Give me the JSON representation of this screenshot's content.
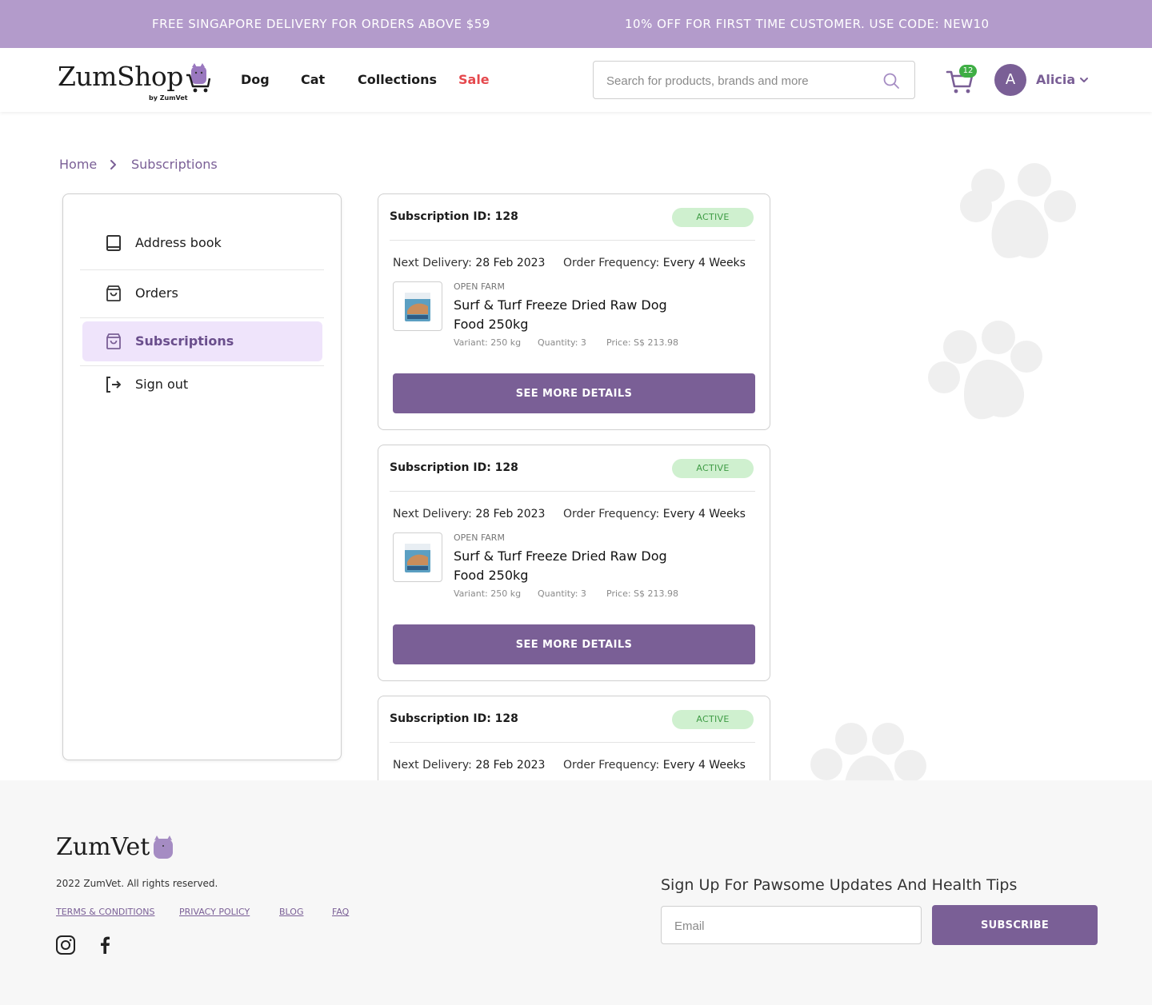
{
  "promo": {
    "left_text": "FREE SINGAPORE DELIVERY FOR ORDERS ABOVE $59",
    "right_text": "10% OFF FOR FIRST TIME CUSTOMER. USE CODE: NEW10"
  },
  "header": {
    "logo_text": "ZumShop",
    "logo_sub": "by ZumVet",
    "nav": [
      {
        "label": "Dog"
      },
      {
        "label": "Cat"
      },
      {
        "label": "Collections"
      },
      {
        "label": "Sale"
      }
    ],
    "search_placeholder": "Search for products, brands and more",
    "cart_count": "12",
    "user_initial": "A",
    "user_name": "Alicia"
  },
  "breadcrumb": {
    "home": "Home",
    "current": "Subscriptions"
  },
  "sidebar": {
    "items": [
      {
        "label": "Address book",
        "icon": "book-icon"
      },
      {
        "label": "Orders",
        "icon": "bag-icon"
      },
      {
        "label": "Subscriptions",
        "icon": "bag-icon",
        "active": true
      },
      {
        "label": "Sign out",
        "icon": "sign-out-icon"
      }
    ]
  },
  "subscriptions": [
    {
      "id_label": "Subscription ID: 128",
      "status": "ACTIVE",
      "next_delivery_label": "Next Delivery:",
      "next_delivery_value": "28 Feb 2023",
      "frequency_label": "Order Frequency:",
      "frequency_value": "Every 4 Weeks",
      "brand": "OPEN FARM",
      "product_name": "Surf & Turf Freeze Dried Raw Dog Food 250kg",
      "variant": "Variant: 250 kg",
      "quantity": "Quantity: 3",
      "price": "Price: S$ 213.98",
      "button_label": "SEE MORE DETAILS"
    },
    {
      "id_label": "Subscription ID: 128",
      "status": "ACTIVE",
      "next_delivery_label": "Next Delivery:",
      "next_delivery_value": "28 Feb 2023",
      "frequency_label": "Order Frequency:",
      "frequency_value": "Every 4 Weeks",
      "brand": "OPEN FARM",
      "product_name": "Surf & Turf Freeze Dried Raw Dog Food 250kg",
      "variant": "Variant: 250 kg",
      "quantity": "Quantity: 3",
      "price": "Price: S$ 213.98",
      "button_label": "SEE MORE DETAILS"
    },
    {
      "id_label": "Subscription ID: 128",
      "status": "ACTIVE",
      "next_delivery_label": "Next Delivery:",
      "next_delivery_value": "28 Feb 2023",
      "frequency_label": "Order Frequency:",
      "frequency_value": "Every 4 Weeks"
    }
  ],
  "footer": {
    "logo_text": "ZumVet",
    "copyright": "2022 ZumVet. All rights reserved.",
    "links": [
      {
        "label": "TERMS & CONDITIONS"
      },
      {
        "label": "PRIVACY POLICY"
      },
      {
        "label": "BLOG"
      },
      {
        "label": "FAQ"
      }
    ],
    "social": [
      "instagram-icon",
      "facebook-icon"
    ],
    "newsletter_title": "Sign Up For Pawsome Updates And Health Tips",
    "email_placeholder": "Email",
    "subscribe_label": "SUBSCRIBE"
  },
  "colors": {
    "promo_bg": "#b39bcb",
    "brand_purple": "#7a5f96",
    "sale_red": "#e5484d",
    "active_bg": "#cff0cf",
    "active_text": "#3e9b44",
    "sidebar_active_bg": "#efe4fb"
  }
}
